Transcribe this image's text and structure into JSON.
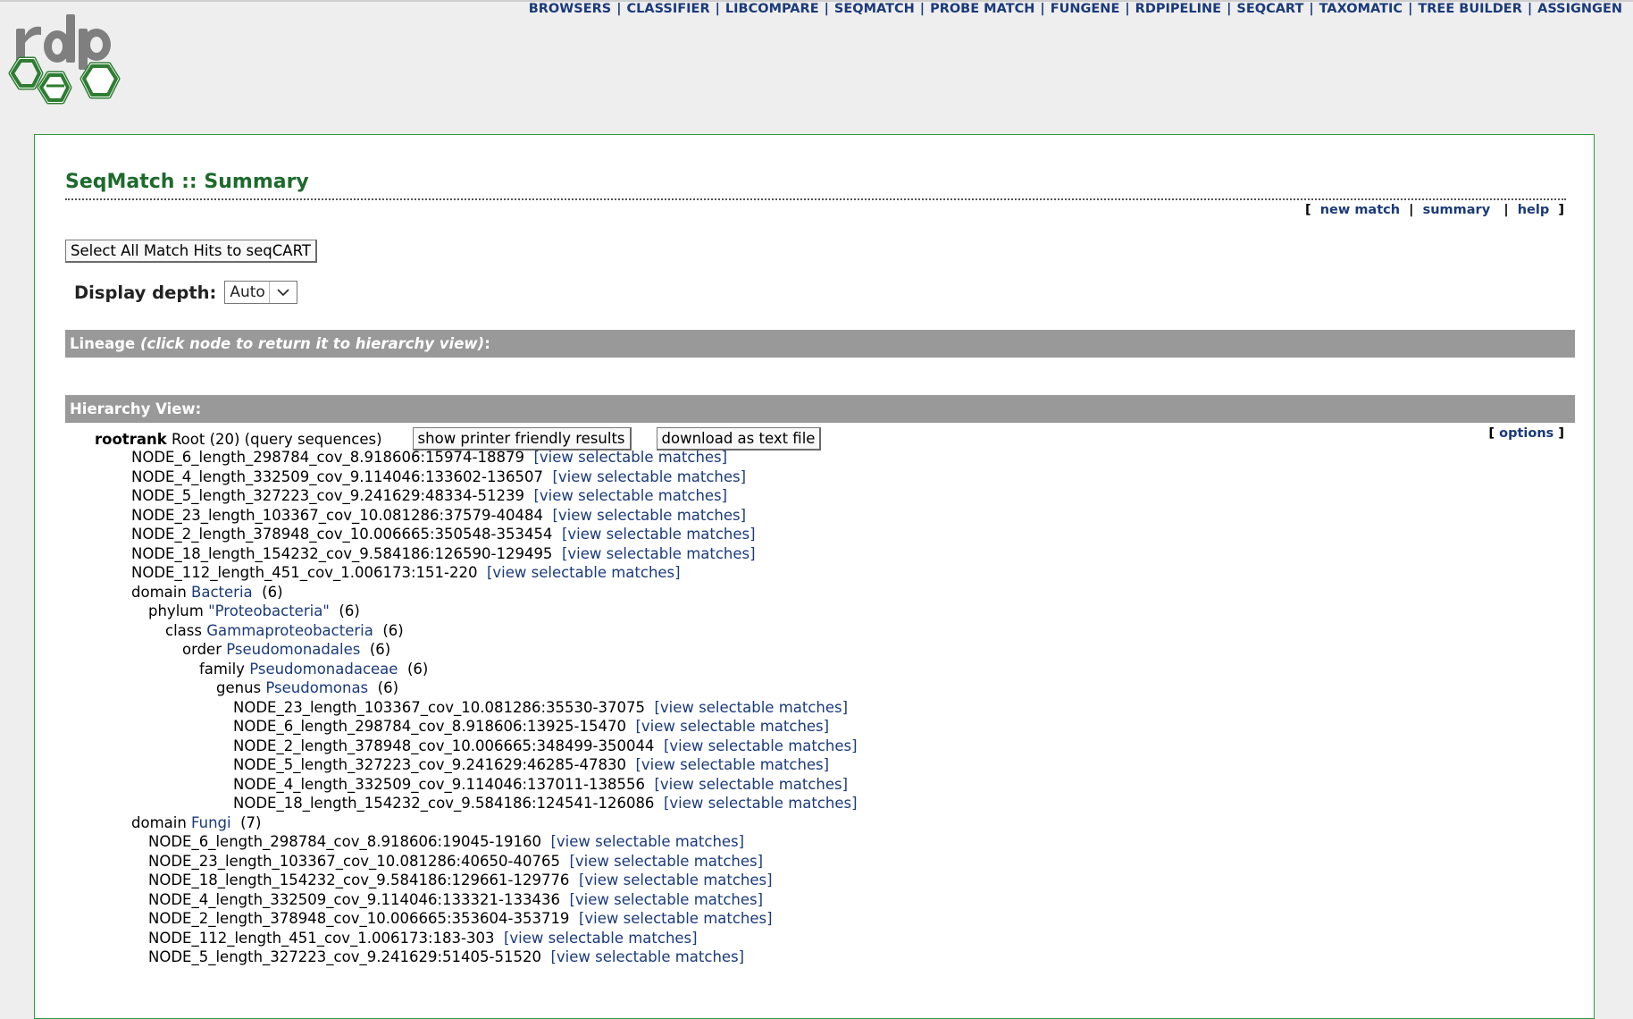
{
  "nav": {
    "items": [
      "BROWSERS",
      "CLASSIFIER",
      "LIBCOMPARE",
      "SEQMATCH",
      "PROBE MATCH",
      "FUNGENE",
      "RDPIPELINE",
      "SEQCART",
      "TAXOMATIC",
      "TREE BUILDER",
      "ASSIGNGEN"
    ]
  },
  "logo": {
    "text": "rdp",
    "brand_color": "#2e7d32"
  },
  "page": {
    "title": "SeqMatch :: Summary",
    "sublinks": {
      "open": "[",
      "new_match": "new match",
      "summary": "summary",
      "help": "help",
      "close": "]"
    }
  },
  "controls": {
    "select_all_label": "Select All Match Hits to seqCART",
    "depth_label": "Display depth:",
    "depth_value": "Auto"
  },
  "lineage_bar": {
    "label": "Lineage",
    "hint": "(click node to return it to hierarchy view)",
    "colon": ":"
  },
  "hierarchy": {
    "label": "Hierarchy View:",
    "root_rank": "rootrank",
    "root_name": "Root (20) (query sequences)",
    "printer_button": "show printer friendly results",
    "download_button": "download as text file",
    "options_open": "[",
    "options_label": "options",
    "options_close": "]",
    "match_link": "[view selectable matches]"
  },
  "tree_rows": [
    {
      "type": "node",
      "level": 0,
      "text": "NODE_6_length_298784_cov_8.918606:15974-18879"
    },
    {
      "type": "node",
      "level": 0,
      "text": "NODE_4_length_332509_cov_9.114046:133602-136507"
    },
    {
      "type": "node",
      "level": 0,
      "text": "NODE_5_length_327223_cov_9.241629:48334-51239"
    },
    {
      "type": "node",
      "level": 0,
      "text": "NODE_23_length_103367_cov_10.081286:37579-40484"
    },
    {
      "type": "node",
      "level": 0,
      "text": "NODE_2_length_378948_cov_10.006665:350548-353454"
    },
    {
      "type": "node",
      "level": 0,
      "text": "NODE_18_length_154232_cov_9.584186:126590-129495"
    },
    {
      "type": "node",
      "level": 0,
      "text": "NODE_112_length_451_cov_1.006173:151-220"
    },
    {
      "type": "taxon",
      "level": 0,
      "rank": "domain",
      "name": "Bacteria",
      "count": "(6)"
    },
    {
      "type": "taxon",
      "level": 1,
      "rank": "phylum",
      "name": "\"Proteobacteria\"",
      "count": "(6)"
    },
    {
      "type": "taxon",
      "level": 2,
      "rank": "class",
      "name": "Gammaproteobacteria",
      "count": "(6)"
    },
    {
      "type": "taxon",
      "level": 3,
      "rank": "order",
      "name": "Pseudomonadales",
      "count": "(6)"
    },
    {
      "type": "taxon",
      "level": 4,
      "rank": "family",
      "name": "Pseudomonadaceae",
      "count": "(6)"
    },
    {
      "type": "taxon",
      "level": 5,
      "rank": "genus",
      "name": "Pseudomonas",
      "count": "(6)"
    },
    {
      "type": "node",
      "level": 6,
      "text": "NODE_23_length_103367_cov_10.081286:35530-37075"
    },
    {
      "type": "node",
      "level": 6,
      "text": "NODE_6_length_298784_cov_8.918606:13925-15470"
    },
    {
      "type": "node",
      "level": 6,
      "text": "NODE_2_length_378948_cov_10.006665:348499-350044"
    },
    {
      "type": "node",
      "level": 6,
      "text": "NODE_5_length_327223_cov_9.241629:46285-47830"
    },
    {
      "type": "node",
      "level": 6,
      "text": "NODE_4_length_332509_cov_9.114046:137011-138556"
    },
    {
      "type": "node",
      "level": 6,
      "text": "NODE_18_length_154232_cov_9.584186:124541-126086"
    },
    {
      "type": "taxon",
      "level": 0,
      "rank": "domain",
      "name": "Fungi",
      "count": "(7)"
    },
    {
      "type": "node",
      "level": 1,
      "text": "NODE_6_length_298784_cov_8.918606:19045-19160"
    },
    {
      "type": "node",
      "level": 1,
      "text": "NODE_23_length_103367_cov_10.081286:40650-40765"
    },
    {
      "type": "node",
      "level": 1,
      "text": "NODE_18_length_154232_cov_9.584186:129661-129776"
    },
    {
      "type": "node",
      "level": 1,
      "text": "NODE_4_length_332509_cov_9.114046:133321-133436"
    },
    {
      "type": "node",
      "level": 1,
      "text": "NODE_2_length_378948_cov_10.006665:353604-353719"
    },
    {
      "type": "node",
      "level": 1,
      "text": "NODE_112_length_451_cov_1.006173:183-303"
    },
    {
      "type": "node",
      "level": 1,
      "text": "NODE_5_length_327223_cov_9.241629:51405-51520"
    }
  ],
  "colors": {
    "link": "#1a3a7a",
    "title": "#1d6a2c",
    "bar": "#999999",
    "panel_border": "#2e9a3e"
  }
}
